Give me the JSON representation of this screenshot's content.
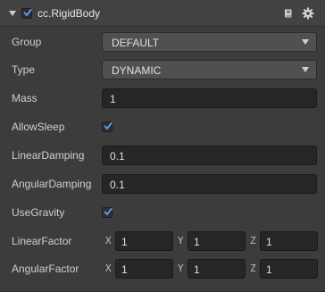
{
  "component": {
    "title": "cc.RigidBody",
    "enabled": true,
    "icons": [
      "fold-icon",
      "book-icon",
      "gear-icon"
    ]
  },
  "fields": {
    "group": {
      "label": "Group",
      "value": "DEFAULT"
    },
    "type": {
      "label": "Type",
      "value": "DYNAMIC"
    },
    "mass": {
      "label": "Mass",
      "value": "1"
    },
    "allow_sleep": {
      "label": "AllowSleep",
      "checked": true
    },
    "linear_damping": {
      "label": "LinearDamping",
      "value": "0.1"
    },
    "angular_damping": {
      "label": "AngularDamping",
      "value": "0.1"
    },
    "use_gravity": {
      "label": "UseGravity",
      "checked": true
    },
    "linear_factor": {
      "label": "LinearFactor",
      "x_label": "X",
      "x": "1",
      "y_label": "Y",
      "y": "1",
      "z_label": "Z",
      "z": "1"
    },
    "angular_factor": {
      "label": "AngularFactor",
      "x_label": "X",
      "x": "1",
      "y_label": "Y",
      "y": "1",
      "z_label": "Z",
      "z": "1"
    }
  },
  "colors": {
    "panel_bg": "#3c3c3c",
    "checkbox_check": "#5aa3ff",
    "input_bg": "#262626",
    "select_bg": "#505050"
  }
}
